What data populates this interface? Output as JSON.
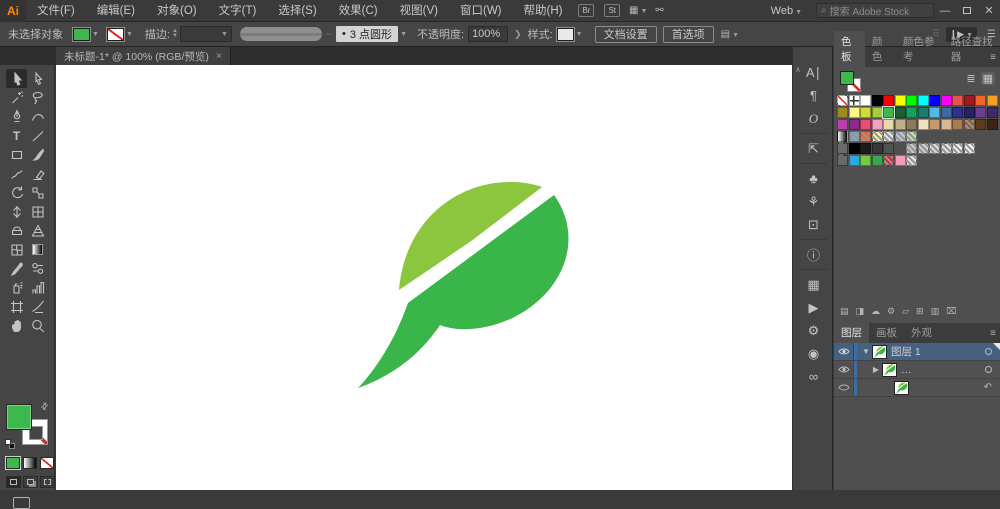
{
  "titlebar": {
    "app": "Ai",
    "workspace": "Web",
    "search_placeholder": "搜索 Adobe Stock",
    "br": "Br",
    "st": "St"
  },
  "menubar": {
    "items": [
      "文件(F)",
      "编辑(E)",
      "对象(O)",
      "文字(T)",
      "选择(S)",
      "效果(C)",
      "视图(V)",
      "窗口(W)",
      "帮助(H)"
    ]
  },
  "control_bar": {
    "no_selection": "未选择对象",
    "stroke_label": "描边:",
    "brush_dot": "•",
    "brush_name": "3 点圆形",
    "opacity_label": "不透明度:",
    "opacity_value": "100%",
    "style_label": "样式:",
    "doc_setup": "文档设置",
    "preferences": "首选项"
  },
  "document_tab": {
    "title": "未标题-1* @ 100% (RGB/预览)",
    "close": "×"
  },
  "tools": {
    "items": [
      {
        "name": "selection-tool",
        "active": true
      },
      {
        "name": "direct-selection-tool"
      },
      {
        "name": "magic-wand-tool"
      },
      {
        "name": "lasso-tool"
      },
      {
        "name": "pen-tool"
      },
      {
        "name": "curvature-tool"
      },
      {
        "name": "type-tool"
      },
      {
        "name": "line-segment-tool"
      },
      {
        "name": "rectangle-tool"
      },
      {
        "name": "paintbrush-tool"
      },
      {
        "name": "shaper-tool"
      },
      {
        "name": "eraser-tool"
      },
      {
        "name": "rotate-tool"
      },
      {
        "name": "scale-tool"
      },
      {
        "name": "width-tool"
      },
      {
        "name": "free-transform-tool"
      },
      {
        "name": "shape-builder-tool"
      },
      {
        "name": "perspective-grid-tool"
      },
      {
        "name": "mesh-tool"
      },
      {
        "name": "gradient-tool"
      },
      {
        "name": "eyedropper-tool"
      },
      {
        "name": "blend-tool"
      },
      {
        "name": "symbol-sprayer-tool"
      },
      {
        "name": "column-graph-tool"
      },
      {
        "name": "artboard-tool"
      },
      {
        "name": "slice-tool"
      },
      {
        "name": "hand-tool"
      },
      {
        "name": "zoom-tool"
      }
    ]
  },
  "fill_stroke": {
    "fill": "#3cb94c",
    "stroke": "none"
  },
  "dock": {
    "items": [
      "character-panel-icon",
      "paragraph-panel-icon",
      "opentype-panel-icon",
      "sep",
      "export-panel-icon",
      "sep",
      "symbols-panel-icon",
      "graphic-styles-panel-icon",
      "artboards-panel-icon",
      "sep",
      "info-panel-icon",
      "sep",
      "transform-panel-icon",
      "actions-panel-icon",
      "gear-panel-icon",
      "cc-libraries-panel-icon",
      "links-panel-icon"
    ]
  },
  "swatches_panel": {
    "tabs": [
      "色板",
      "颜色",
      "颜色参考",
      "路径查找器"
    ],
    "active_tab": "色板",
    "rows": [
      [
        "none",
        "reg",
        "#ffffff",
        "#000000",
        "#ff0000",
        "#ffff00",
        "#00ff00",
        "#00ffff",
        "#0000ff",
        "#ff00ff",
        "#e8534a",
        "#9e1b1f",
        "#f2622b",
        "#f7a021"
      ],
      [
        "#a08a1f",
        "#fff685",
        "#d3db3a",
        "#a6ce39",
        {
          "c": "#3cb94a",
          "selected": true
        },
        "#1e5e33",
        "#17a05e",
        "#1b7e6b",
        "#53b7e8",
        "#3b6aa0",
        "#2e3192",
        "#262262",
        "#6b3f94",
        "#3f2a68"
      ],
      [
        "#bc3fae",
        "#8c2b8c",
        "#e94e77",
        "#f2a0c0",
        "#e8d9a8",
        "#c0ae8a",
        "#8c7a5e",
        "#efe0bf",
        "#c49a6c",
        "#d8b894",
        "#a87c50",
        "p:#8a5c34",
        "#5e3a1e",
        "#3e2410"
      ],
      [
        "g:gray",
        "p:#7da7d9",
        "p:#f26522",
        "p:#fff9ae",
        "p:#e6e7e8",
        "p:#bdccd4",
        "p:#c5e0b4"
      ],
      [
        "folder",
        "#000000",
        "#1c1c1c",
        "#383838",
        "#515151",
        "",
        "p:#c8c9cb",
        "p:#d1d3d4",
        "p:#dcddde",
        "p:#e6e7e8",
        "p:#f1f2f2",
        "p:#fafafa"
      ],
      [
        "folder",
        "#29abe2",
        "#7ac943",
        "#3aa655",
        "p:#ed1c24",
        "#f49ac1",
        "p:#e6e6e6"
      ]
    ],
    "footer_icons": [
      "swatch-libraries-icon",
      "show-swatch-kinds-icon",
      "cc-library-add-icon",
      "swatch-options-icon",
      "new-color-group-icon",
      "new-swatch-icon",
      "swatch-list-icon",
      "delete-swatch-icon"
    ]
  },
  "layers_panel": {
    "tabs": [
      "图层",
      "画板",
      "外观"
    ],
    "active_tab": "图层",
    "rows": [
      {
        "label": "图层 1",
        "selected": true
      },
      {
        "label": "…"
      },
      {
        "label": ""
      }
    ]
  },
  "canvas": {
    "leaf_light": "#8cc63e",
    "leaf_dark": "#3ab54a"
  }
}
